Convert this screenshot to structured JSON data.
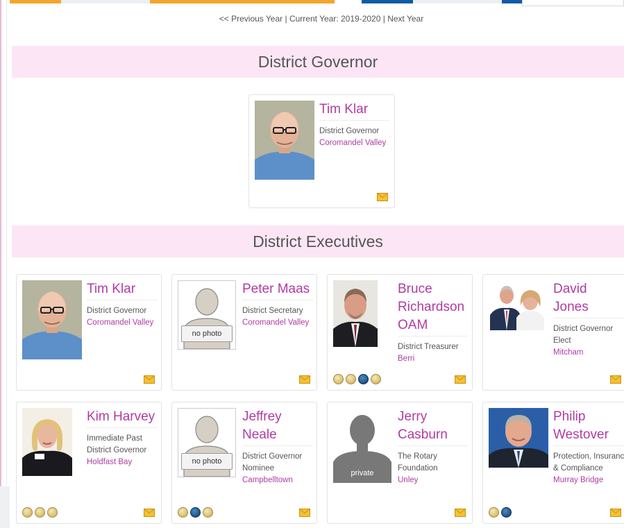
{
  "year_nav": {
    "previous": "<< Previous Year",
    "current": "| Current Year: 2019-2020 |",
    "next": "Next Year"
  },
  "sections": {
    "governor": "District Governor",
    "executives": "District Executives"
  },
  "governor": {
    "name": "Tim Klar",
    "role": "District Governor",
    "club": "Coromandel Valley"
  },
  "executives": [
    {
      "name": "Tim Klar",
      "role": "District Governor",
      "club": "Coromandel Valley"
    },
    {
      "name": "Peter Maas",
      "role": "District Secretary",
      "club": "Coromandel Valley",
      "photo_label": "no photo"
    },
    {
      "name": "Bruce Richardson OAM",
      "role": "District Treasurer",
      "club": "Berri"
    },
    {
      "name": "David Jones",
      "role": "District Governor Elect",
      "club": "Mitcham"
    },
    {
      "name": "Kim Harvey",
      "role": "Immediate Past District Governor",
      "club": "Holdfast Bay"
    },
    {
      "name": "Jeffrey Neale",
      "role": "District Governor Nominee",
      "club": "Campbelltown",
      "photo_label": "no photo"
    },
    {
      "name": "Jerry Casburn",
      "role": "The Rotary Foundation",
      "club": "Unley",
      "photo_label": "private"
    },
    {
      "name": "Philip Westover",
      "role": "Protection, Insurance & Compliance",
      "club": "Murray Bridge"
    }
  ],
  "colors": {
    "accent": "#b03ca2",
    "band": "#fce6f6",
    "top_orange": "#f2a62b",
    "top_blue": "#0e5aa6"
  },
  "icons": {
    "mail": "envelope-icon",
    "badge": "award-badge-icon"
  }
}
